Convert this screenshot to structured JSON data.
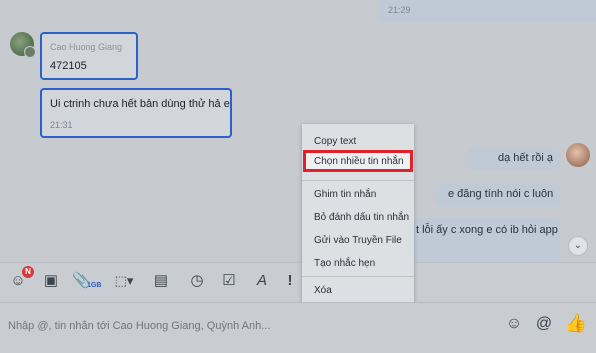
{
  "conversation": {
    "top_time": "21:29",
    "incoming": {
      "sender": "Cao Huong Giang",
      "message1": "472105",
      "message2": "Ui ctrinh chưa hết bản dùng thử hả e",
      "time": "21:31"
    },
    "outgoing": [
      "dạ hết rồi ạ",
      "e đăng tính nói c luôn",
      "t lỗi ấy c xong e có ib hỏi app"
    ]
  },
  "context_menu": {
    "items": [
      "Copy text",
      "Chọn nhiều tin nhắn",
      "Ghim tin nhắn",
      "Bỏ đánh dấu tin nhắn",
      "Gửi vào Truyền File",
      "Tạo nhắc hẹn",
      "Xóa"
    ]
  },
  "toolbar": {
    "sticker_badge": "N",
    "file_size": "1GB",
    "icons": [
      "sticker-icon",
      "image-icon",
      "attach-icon",
      "screenshot-icon",
      "contact-card-icon",
      "reminder-icon",
      "task-icon",
      "format-icon",
      "urgent-icon"
    ]
  },
  "composer": {
    "placeholder": "Nhập @, tin nhắn tới Cao Huong Giang, Quỳnh Anh..."
  },
  "colors": {
    "selection_border": "#2a63c8",
    "highlight_border": "#e3202a",
    "badge": "#d93838"
  }
}
